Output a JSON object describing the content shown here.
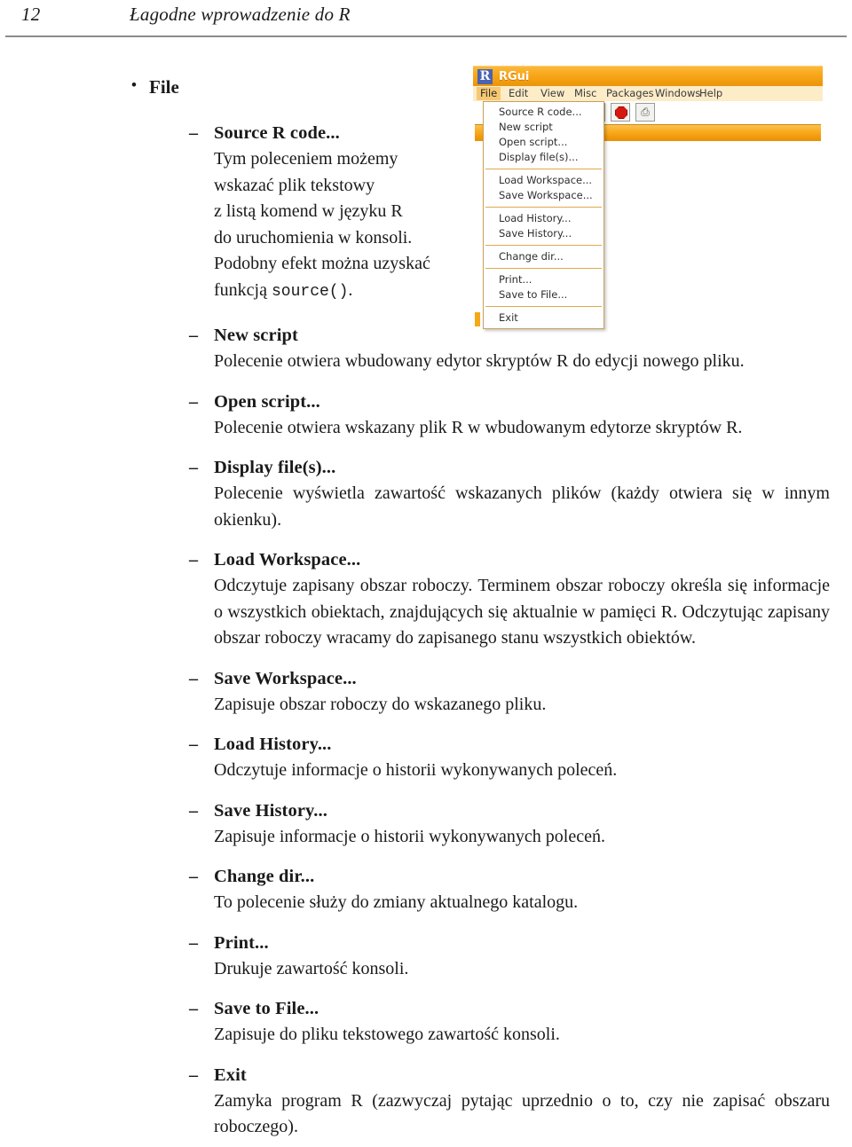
{
  "header": {
    "folio": "12",
    "running_title": "Łagodne wprowadzenie do R"
  },
  "list": {
    "bullet_mark": "•",
    "dash_mark": "–",
    "top_item": "File",
    "entries": [
      {
        "title": "Source R code...",
        "body_lines": [
          "Tym poleceniem możemy",
          "wskazać plik tekstowy",
          "z listą komend w języku R",
          "do uruchomienia w konsoli.",
          "Podobny efekt można uzyskać"
        ],
        "body_tail_prefix": "funkcją ",
        "body_tail_code": "source()",
        "body_tail_suffix": "."
      },
      {
        "title": "New script",
        "body": "Polecenie otwiera wbudowany edytor skryptów R do edycji nowego pliku."
      },
      {
        "title": "Open script...",
        "body": "Polecenie otwiera wskazany plik R w wbudowanym edytorze skryptów R."
      },
      {
        "title": "Display file(s)...",
        "body": "Polecenie wyświetla zawartość wskazanych plików (każdy otwiera się w innym okienku)."
      },
      {
        "title": "Load Workspace...",
        "body": "Odczytuje zapisany obszar roboczy. Terminem obszar roboczy określa się informacje o wszystkich obiektach, znajdujących się aktualnie w pamięci R. Odczytując zapisany obszar roboczy wracamy do zapisanego stanu wszystkich obiektów."
      },
      {
        "title": "Save Workspace...",
        "body": "Zapisuje obszar roboczy do wskazanego pliku."
      },
      {
        "title": "Load History...",
        "body": "Odczytuje informacje o historii wykonywanych poleceń."
      },
      {
        "title": "Save History...",
        "body": "Zapisuje informacje o historii wykonywanych poleceń."
      },
      {
        "title": "Change dir...",
        "body": "To polecenie służy do zmiany aktualnego katalogu."
      },
      {
        "title": "Print...",
        "body": "Drukuje zawartość konsoli."
      },
      {
        "title": "Save to File...",
        "body": "Zapisuje do pliku tekstowego zawartość konsoli."
      },
      {
        "title": "Exit",
        "body": "Zamyka program R (zazwyczaj pytając uprzednio o to, czy nie zapisać obszaru roboczego)."
      }
    ]
  },
  "figure": {
    "window_title": "RGui",
    "app_icon_letter": "R",
    "menubar": [
      "File",
      "Edit",
      "View",
      "Misc",
      "Packages",
      "Windows",
      "Help"
    ],
    "active_menu": "File",
    "toolbar_icons": [
      "refresh-icon",
      "stop-icon",
      "print-icon"
    ],
    "toolbar_glyphs": {
      "refresh": "↻",
      "print": "⎙"
    },
    "file_menu_groups": [
      [
        "Source R code...",
        "New script",
        "Open script...",
        "Display file(s)..."
      ],
      [
        "Load Workspace...",
        "Save Workspace..."
      ],
      [
        "Load History...",
        "Save History..."
      ],
      [
        "Change dir..."
      ],
      [
        "Print...",
        "Save to File..."
      ],
      [
        "Exit"
      ]
    ]
  },
  "colors": {
    "titlebar_orange": "#f5a011",
    "menubar_cream": "#fdecc8",
    "menu_separator": "#e0a94e",
    "stop_red": "#d6170f",
    "r_icon_blue": "#4b63b0",
    "header_rule": "#8b8b8b"
  }
}
